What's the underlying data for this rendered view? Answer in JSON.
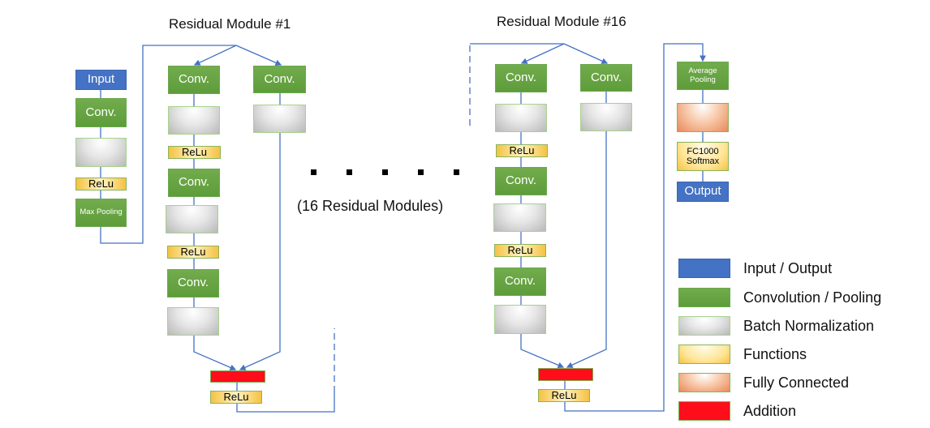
{
  "titles": {
    "module_first": "Residual Module #1",
    "module_last": "Residual Module #16",
    "ellipsis_note": "(16 Residual Modules)"
  },
  "stem": {
    "input": "Input",
    "conv": "Conv.",
    "relu": "ReLu",
    "maxpool": "Max Pooling"
  },
  "module1": {
    "main_branch": [
      "Conv.",
      "ReLu",
      "Conv.",
      "ReLu",
      "Conv."
    ],
    "shortcut_branch": [
      "Conv."
    ],
    "post_add_relu": "ReLu"
  },
  "module16": {
    "main_branch": [
      "Conv.",
      "ReLu",
      "Conv.",
      "ReLu",
      "Conv."
    ],
    "shortcut_branch": [
      "Conv."
    ],
    "post_add_relu": "ReLu"
  },
  "head": {
    "avgpool": "Average Pooling",
    "fc_softmax": "FC1000 Softmax",
    "output": "Output"
  },
  "legend": [
    {
      "key": "io",
      "label": "Input / Output",
      "color": "#4472c4"
    },
    {
      "key": "conv",
      "label": "Convolution / Pooling",
      "color": "#70ad47"
    },
    {
      "key": "bn",
      "label": "Batch Normalization",
      "color": "#c0c0c0"
    },
    {
      "key": "fn",
      "label": "Functions",
      "color": "#ffc000"
    },
    {
      "key": "fc",
      "label": "Fully Connected",
      "color": "#f4b183"
    },
    {
      "key": "add",
      "label": "Addition",
      "color": "#ff0000"
    }
  ],
  "colors": {
    "line": "#4472c4",
    "io": "#4472c4",
    "conv": "#70ad47",
    "addition": "#ff0000"
  }
}
